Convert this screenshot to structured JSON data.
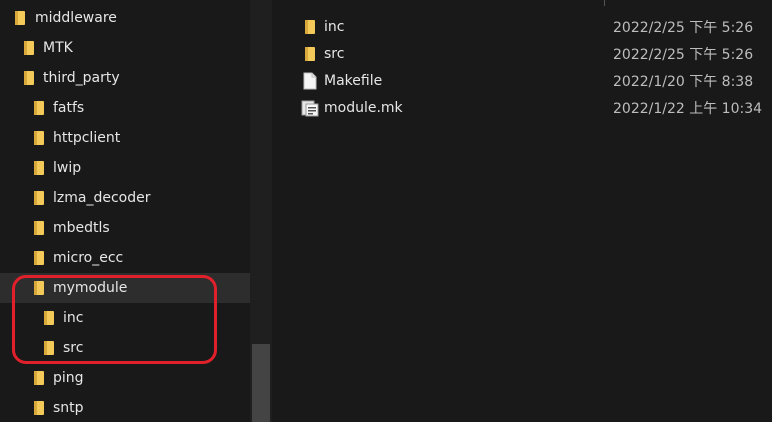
{
  "nav_tree": {
    "items": [
      {
        "label": "middleware",
        "expanded": true
      },
      {
        "label": "MTK"
      },
      {
        "label": "third_party",
        "expanded": true
      },
      {
        "label": "fatfs"
      },
      {
        "label": "httpclient"
      },
      {
        "label": "lwip"
      },
      {
        "label": "lzma_decoder"
      },
      {
        "label": "mbedtls"
      },
      {
        "label": "micro_ecc"
      },
      {
        "label": "mymodule",
        "selected": true,
        "expanded": true
      },
      {
        "label": "inc"
      },
      {
        "label": "src"
      },
      {
        "label": "ping"
      },
      {
        "label": "sntp"
      }
    ]
  },
  "file_list": {
    "rows": [
      {
        "name": "inc",
        "date": "2022/2/25 下午 5:26",
        "icon": "folder-icon"
      },
      {
        "name": "src",
        "date": "2022/2/25 下午 5:26",
        "icon": "folder-icon"
      },
      {
        "name": "Makefile",
        "date": "2022/1/20 下午 8:38",
        "icon": "document-icon"
      },
      {
        "name": "module.mk",
        "date": "2022/1/22 上午 10:34",
        "icon": "makefile-icon"
      }
    ]
  },
  "colors": {
    "folder": "#f3c95a",
    "folder_dark": "#d9a93b",
    "highlight": "#e0202a",
    "background": "#191919",
    "selected_row": "#2d2d2d"
  }
}
